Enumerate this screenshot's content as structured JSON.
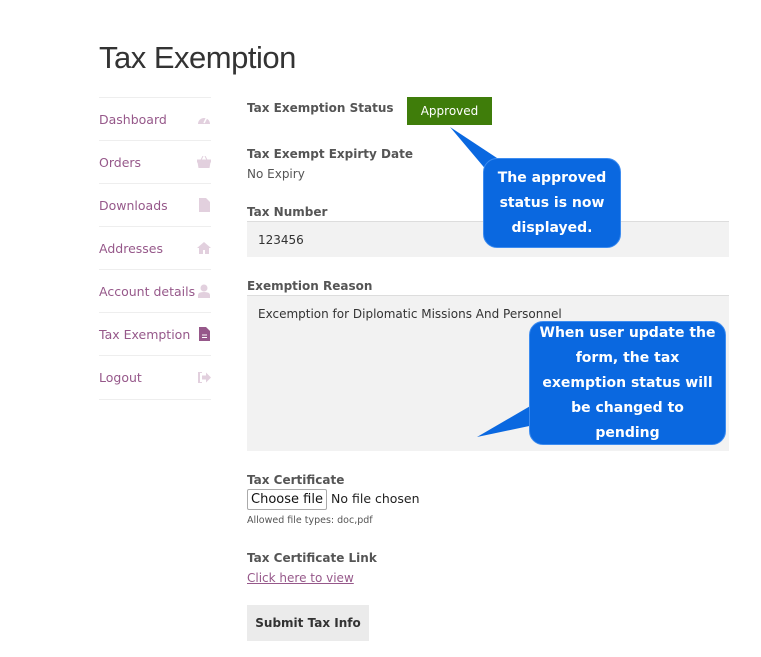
{
  "page_title": "Tax Exemption",
  "nav": [
    {
      "label": "Dashboard",
      "icon": "dashboard-icon"
    },
    {
      "label": "Orders",
      "icon": "basket-icon"
    },
    {
      "label": "Downloads",
      "icon": "file-download-icon"
    },
    {
      "label": "Addresses",
      "icon": "home-icon"
    },
    {
      "label": "Account details",
      "icon": "user-icon"
    },
    {
      "label": "Tax Exemption",
      "icon": "document-icon",
      "active": true
    },
    {
      "label": "Logout",
      "icon": "logout-icon"
    }
  ],
  "form": {
    "status_label": "Tax Exemption Status",
    "status_value": "Approved",
    "status_color": "#3f7d0a",
    "expiry_label": "Tax Exempt Expirty Date",
    "expiry_value": "No Expiry",
    "tax_number_label": "Tax Number",
    "tax_number_value": "123456",
    "reason_label": "Exemption Reason",
    "reason_value": "Excemption for Diplomatic Missions And Personnel",
    "certificate_label": "Tax Certificate",
    "choose_file": "Choose file",
    "no_file": "No file chosen",
    "allowed_types": "Allowed file types: doc,pdf",
    "link_label": "Tax Certificate Link",
    "link_text": "Click here to view",
    "submit": "Submit Tax Info"
  },
  "callouts": {
    "status": "The approved status is now displayed.",
    "update": "When user update the form, the tax exemption status will be changed to pending"
  }
}
